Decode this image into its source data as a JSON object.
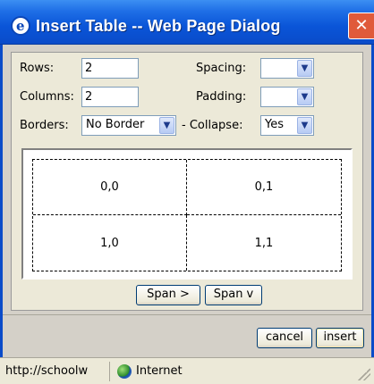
{
  "window": {
    "title": "Insert Table -- Web Page Dialog",
    "close_glyph": "✕",
    "icon": "ie-icon"
  },
  "form": {
    "rows_label": "Rows:",
    "rows_value": "2",
    "columns_label": "Columns:",
    "columns_value": "2",
    "borders_label": "Borders:",
    "borders_value": "No Border",
    "spacing_label": "Spacing:",
    "spacing_value": "",
    "padding_label": "Padding:",
    "padding_value": "",
    "collapse_label": "- Collapse:",
    "collapse_value": "Yes"
  },
  "preview": {
    "cells": [
      [
        "0,0",
        "0,1"
      ],
      [
        "1,0",
        "1,1"
      ]
    ]
  },
  "buttons": {
    "span_right": "Span >",
    "span_down": "Span v",
    "cancel": "cancel",
    "insert": "insert"
  },
  "status": {
    "url": "http://schoolw",
    "zone": "Internet",
    "zone_icon": "globe-icon"
  },
  "colors": {
    "titlebar": "#0a55d8",
    "close": "#e05a3a",
    "panel": "#ece9d8"
  }
}
